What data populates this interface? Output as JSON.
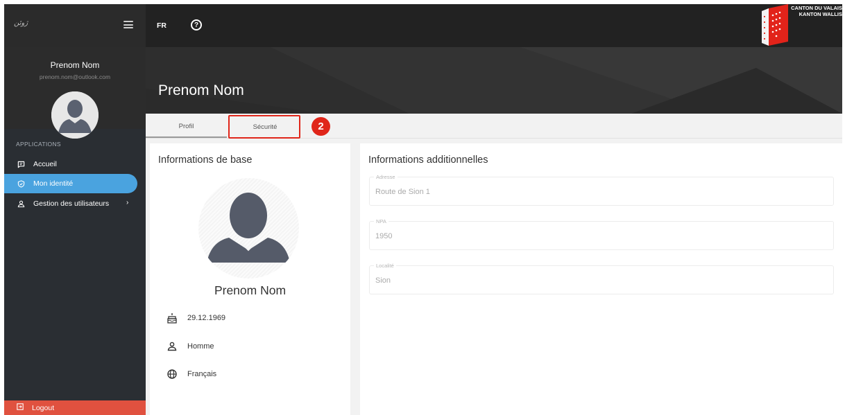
{
  "sidebar": {
    "logo_text": "ژوئن",
    "user_name": "Prenom Nom",
    "user_email": "prenom.nom@outlook.com",
    "section_label": "APPLICATIONS",
    "items": [
      {
        "label": "Accueil",
        "icon": "message-square-icon",
        "active": false
      },
      {
        "label": "Mon identité",
        "icon": "shield-check-icon",
        "active": true
      },
      {
        "label": "Gestion des utilisateurs",
        "icon": "user-icon",
        "active": false,
        "has_submenu": true
      }
    ],
    "logout_label": "Logout"
  },
  "topbar": {
    "language": "FR",
    "help_icon": "help-circle-icon",
    "canton_line1": "CANTON DU VALAIS",
    "canton_line2": "KANTON WALLIS"
  },
  "header": {
    "title": "Prenom Nom"
  },
  "tabs": [
    {
      "label": "Profil",
      "active": true
    },
    {
      "label": "Sécurité",
      "active": false,
      "highlighted": true
    }
  ],
  "step_badge": "2",
  "basic_info": {
    "title": "Informations de base",
    "full_name": "Prenom Nom",
    "birthdate": "29.12.1969",
    "gender": "Homme",
    "language": "Français"
  },
  "additional_info": {
    "title": "Informations additionnelles",
    "fields": [
      {
        "label": "Adresse",
        "value": "Route de Sion 1"
      },
      {
        "label": "NPA",
        "value": "1950"
      },
      {
        "label": "Localité",
        "value": "Sion"
      }
    ]
  },
  "colors": {
    "sidebar_bg": "#2a2e33",
    "active_item": "#4aa3df",
    "logout": "#e0513f",
    "highlight": "#e0261a",
    "canton_red": "#e2231a"
  }
}
